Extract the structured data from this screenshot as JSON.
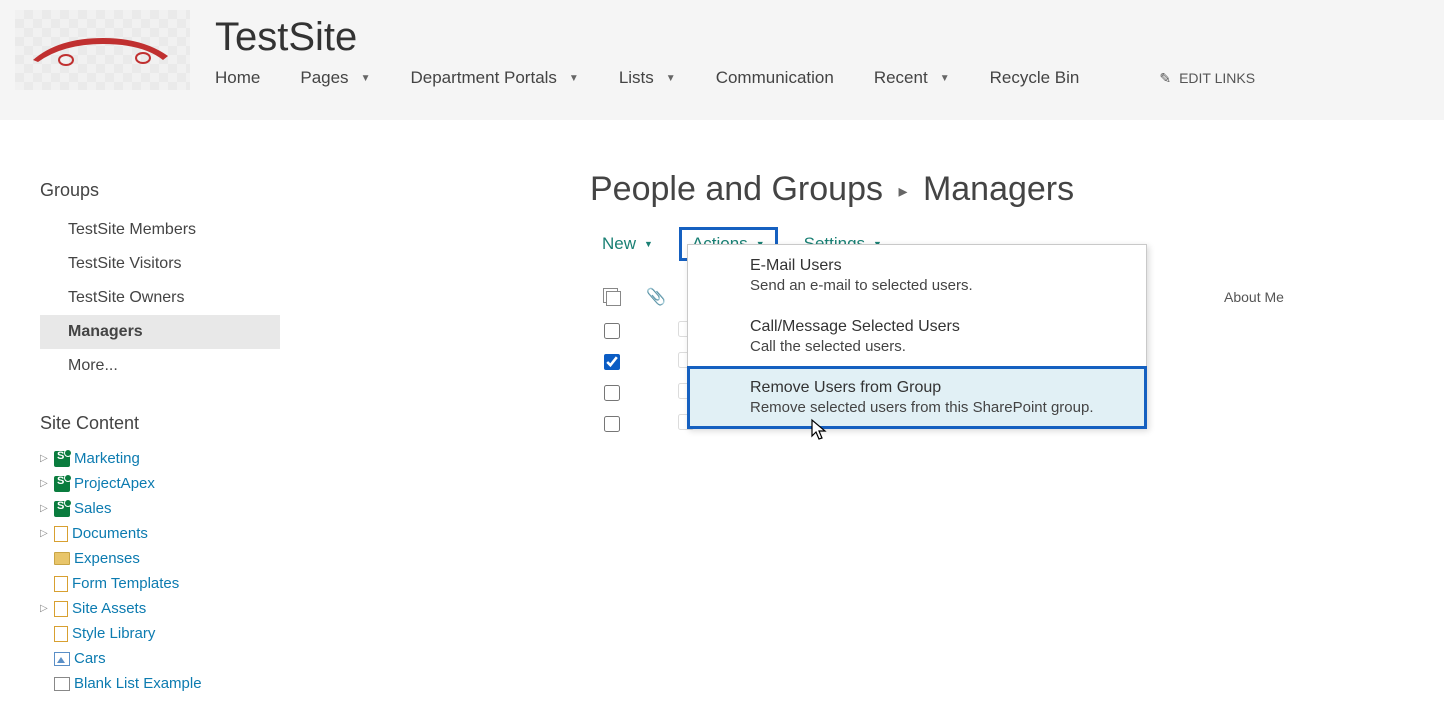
{
  "header": {
    "site_title": "TestSite",
    "nav": [
      "Home",
      "Pages",
      "Department Portals",
      "Lists",
      "Communication",
      "Recent",
      "Recycle Bin"
    ],
    "nav_has_dropdown": [
      false,
      true,
      true,
      true,
      false,
      true,
      false
    ],
    "edit_links": "EDIT LINKS"
  },
  "sidebar": {
    "groups_heading": "Groups",
    "groups": [
      "TestSite Members",
      "TestSite Visitors",
      "TestSite Owners",
      "Managers",
      "More..."
    ],
    "groups_active_index": 3,
    "site_content_heading": "Site Content",
    "tree": [
      {
        "label": "Marketing",
        "icon": "sp",
        "toggle": true,
        "indent": 0
      },
      {
        "label": "ProjectApex",
        "icon": "sp",
        "toggle": true,
        "indent": 0
      },
      {
        "label": "Sales",
        "icon": "sp",
        "toggle": true,
        "indent": 0
      },
      {
        "label": "Documents",
        "icon": "doc",
        "toggle": true,
        "indent": 0
      },
      {
        "label": "Expenses",
        "icon": "folder",
        "toggle": false,
        "indent": 1
      },
      {
        "label": "Form Templates",
        "icon": "doc",
        "toggle": false,
        "indent": 1
      },
      {
        "label": "Site Assets",
        "icon": "doc",
        "toggle": true,
        "indent": 0
      },
      {
        "label": "Style Library",
        "icon": "doc",
        "toggle": false,
        "indent": 1
      },
      {
        "label": "Cars",
        "icon": "pic",
        "toggle": false,
        "indent": 1
      },
      {
        "label": "Blank List Example",
        "icon": "list",
        "toggle": false,
        "indent": 1
      }
    ]
  },
  "content": {
    "title_prefix": "People and Groups",
    "title_suffix": "Managers",
    "toolbar": {
      "new": "New",
      "actions": "Actions",
      "settings": "Settings"
    },
    "columns": {
      "about": "About Me"
    },
    "rows": [
      {
        "checked": false
      },
      {
        "checked": true
      },
      {
        "checked": false
      },
      {
        "checked": false
      }
    ]
  },
  "dropdown": {
    "items": [
      {
        "title": "E-Mail Users",
        "desc": "Send an e-mail to selected users."
      },
      {
        "title": "Call/Message Selected Users",
        "desc": "Call the selected users."
      },
      {
        "title": "Remove Users from Group",
        "desc": "Remove selected users from this SharePoint group."
      }
    ],
    "hover_index": 2
  }
}
